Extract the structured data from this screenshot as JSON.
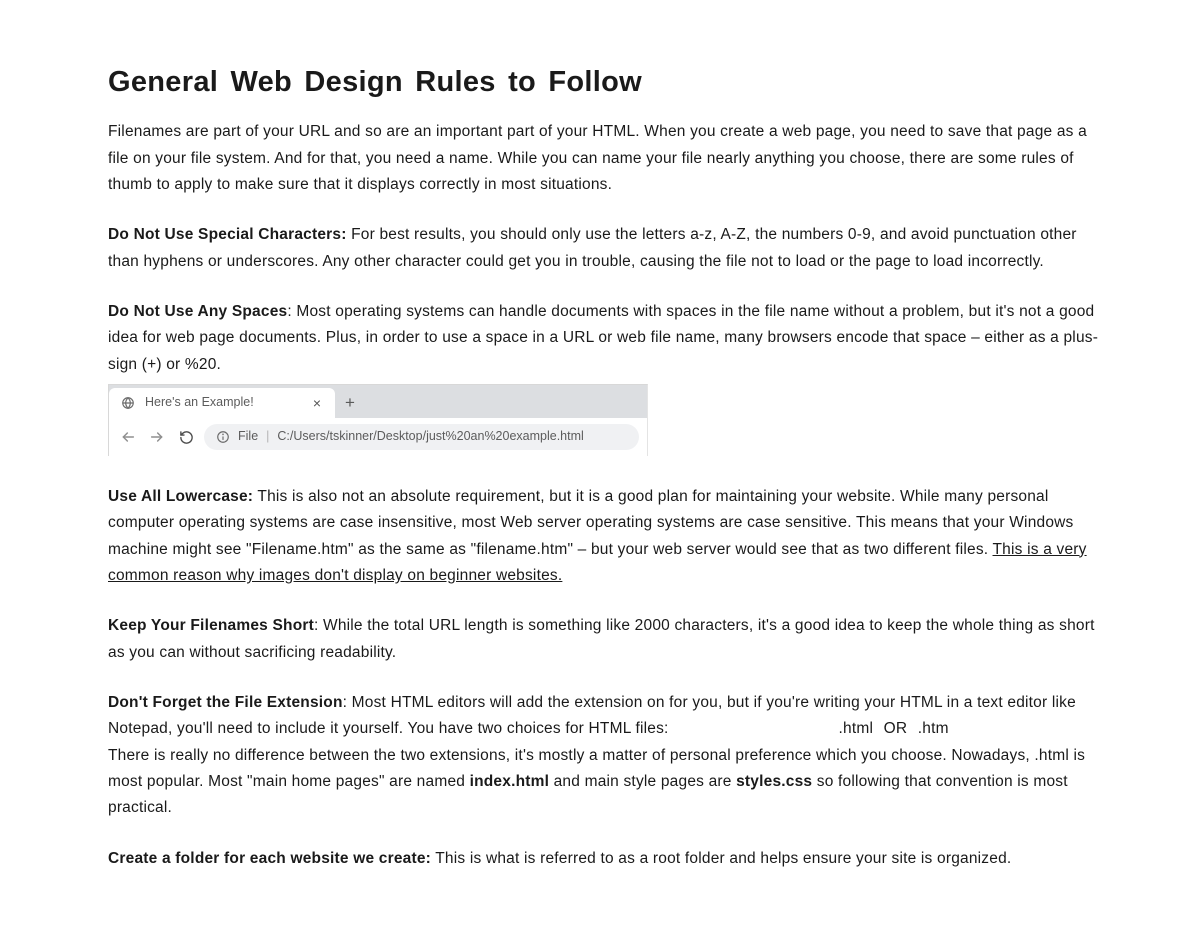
{
  "title": "General Web Design Rules to Follow",
  "intro": "Filenames are part of your URL and so are an important part of your HTML. When you create a web page, you need to save that page as a file on your file system. And for that, you need a name. While you can name your file nearly anything you choose, there are some rules of thumb to apply to make sure that it displays correctly in most situations.",
  "sections": {
    "special_chars": {
      "heading": "Do Not Use Special Characters:",
      "body": " For best results, you should only use the letters a-z, A-Z, the numbers 0-9, and avoid punctuation other than hyphens or underscores. Any other character could get you in trouble, causing the file not to load or the page to load incorrectly."
    },
    "no_spaces": {
      "heading": "Do Not Use Any Spaces",
      "body": ": Most operating systems can handle documents with spaces in the file name without a problem, but it's not a good idea for web page documents. Plus, in order to use a space in a URL or web file name, many browsers encode that space – either as a plus-sign (+) or %20."
    },
    "lowercase": {
      "heading": "Use All Lowercase:",
      "body1": " This is also not an absolute requirement, but it is a good plan for maintaining your website. While many personal computer operating systems are case insensitive, most Web server operating systems are case sensitive. This means that your Windows machine might see \"Filename.htm\" as the same as \"filename.htm\" – but your web server would see that as two different files. ",
      "underlined": "This is a very common reason why images don't display on beginner websites."
    },
    "short": {
      "heading": "Keep Your Filenames Short",
      "body": ": While the total URL length is something like 2000 characters, it's a good idea to keep the whole thing as short as you can without sacrificing readability."
    },
    "extension": {
      "heading": "Don't Forget the File Extension",
      "body1": ": Most HTML editors will add the extension on for you, but if you're writing your HTML in a text editor like Notepad, you'll need to include it yourself. You have two choices for HTML files:",
      "ext_options": ".html  OR  .htm",
      "body2a": "There is really no difference between the two extensions, it's mostly a matter of personal preference which you choose. Nowadays, .html is most popular.  Most \"main home pages\" are named ",
      "bold_index": "index.html",
      "body2b": " and main style pages are ",
      "bold_styles": "styles.css",
      "body2c": " so following that convention is most practical."
    },
    "folder": {
      "heading": "Create a folder for each website we create:",
      "body": " This is what is referred to as a root folder and helps ensure your site is organized."
    }
  },
  "browser": {
    "tab_title": "Here's an Example!",
    "addr_label": "File",
    "addr_path": "C:/Users/tskinner/Desktop/just%20an%20example.html"
  }
}
